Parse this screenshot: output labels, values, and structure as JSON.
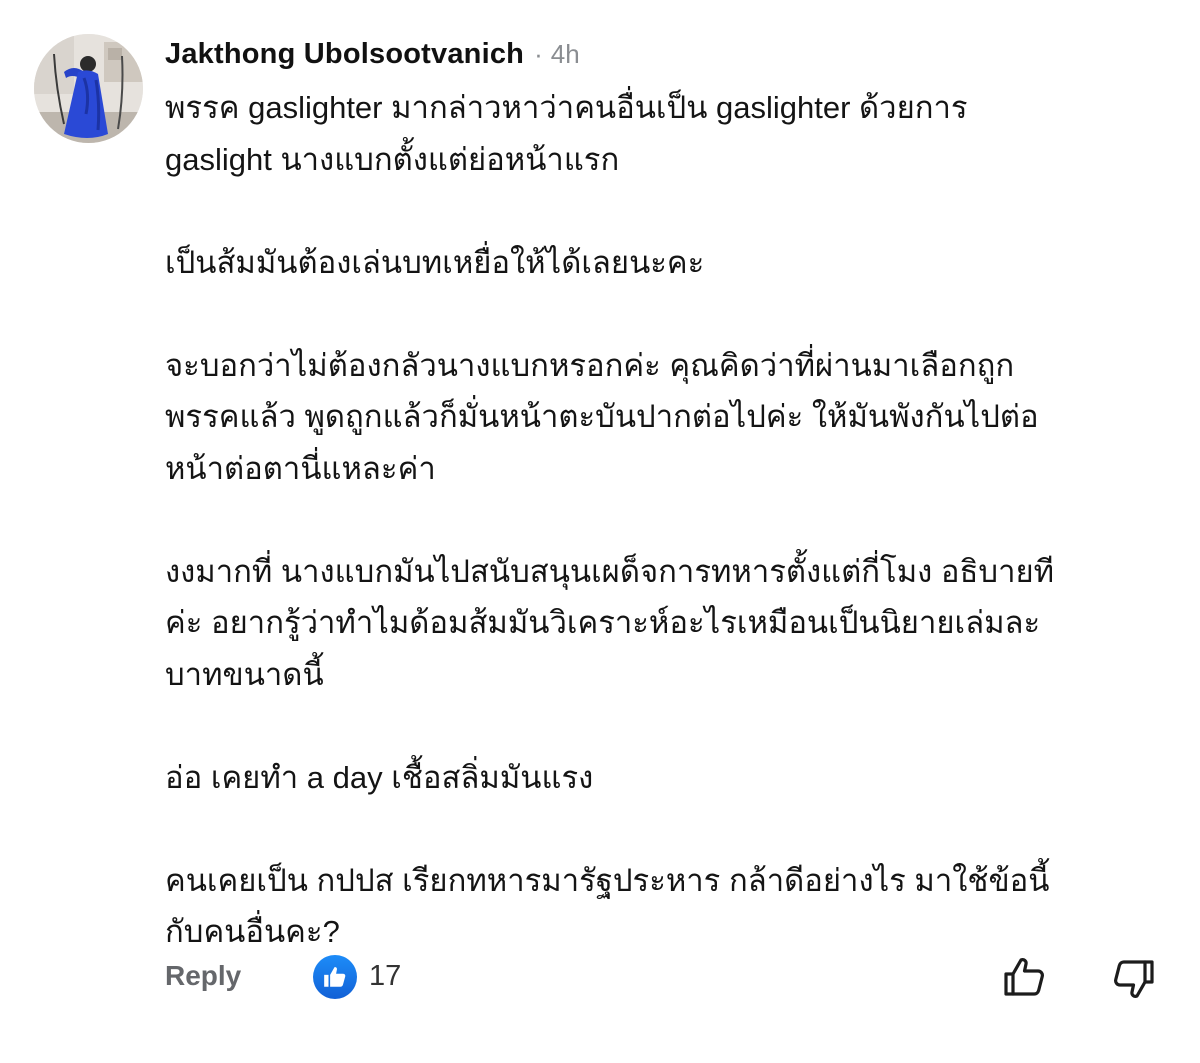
{
  "comment": {
    "author": "Jakthong Ubolsootvanich",
    "separator": "·",
    "time": "4h",
    "paragraphs": [
      {
        "lines": [
          "พรรค gaslighter มากล่าวหาว่าคนอื่นเป็น gaslighter ด้วยการ",
          "gaslight นางแบกตั้งแต่ย่อหน้าแรก"
        ]
      },
      {
        "lines": [
          "เป็นส้มมันต้องเล่นบทเหยื่อให้ได้เลยนะคะ"
        ]
      },
      {
        "lines": [
          "จะบอกว่าไม่ต้องกลัวนางแบกหรอกค่ะ คุณคิดว่าที่ผ่านมาเลือกถูก",
          "พรรคแล้ว พูดถูกแล้วก็มั่นหน้าตะบันปากต่อไปค่ะ ให้มันพังกันไปต่อ",
          "หน้าต่อตานี่แหละค่า"
        ]
      },
      {
        "lines": [
          "งงมากที่ นางแบกมันไปสนับสนุนเผด็จการทหารตั้งแต่กี่โมง  อธิบายที",
          "ค่ะ อยากรู้ว่าทำไมด้อมส้มมันวิเคราะห์อะไรเหมือนเป็นนิยายเล่มละ",
          "บาทขนาดนี้"
        ]
      },
      {
        "lines": [
          "อ่อ เคยทำ a day เชื้อสลิ่มมันแรง"
        ]
      },
      {
        "lines": [
          "คนเคยเป็น กปปส เรียกทหารมารัฐประหาร กล้าดีอย่างไร มาใช้ข้อนี้",
          "กับคนอื่นคะ?"
        ]
      }
    ]
  },
  "actions": {
    "reply_label": "Reply",
    "like_count": "17"
  },
  "icons": {
    "avatar": "avatar-photo",
    "like_badge": "like-thumb-icon",
    "thumb_up": "thumb-up-outline-icon",
    "thumb_down": "thumb-down-outline-icon"
  },
  "colors": {
    "like_blue": "#1877f2",
    "secondary_text": "#65676b",
    "timestamp": "#8a8d91"
  }
}
